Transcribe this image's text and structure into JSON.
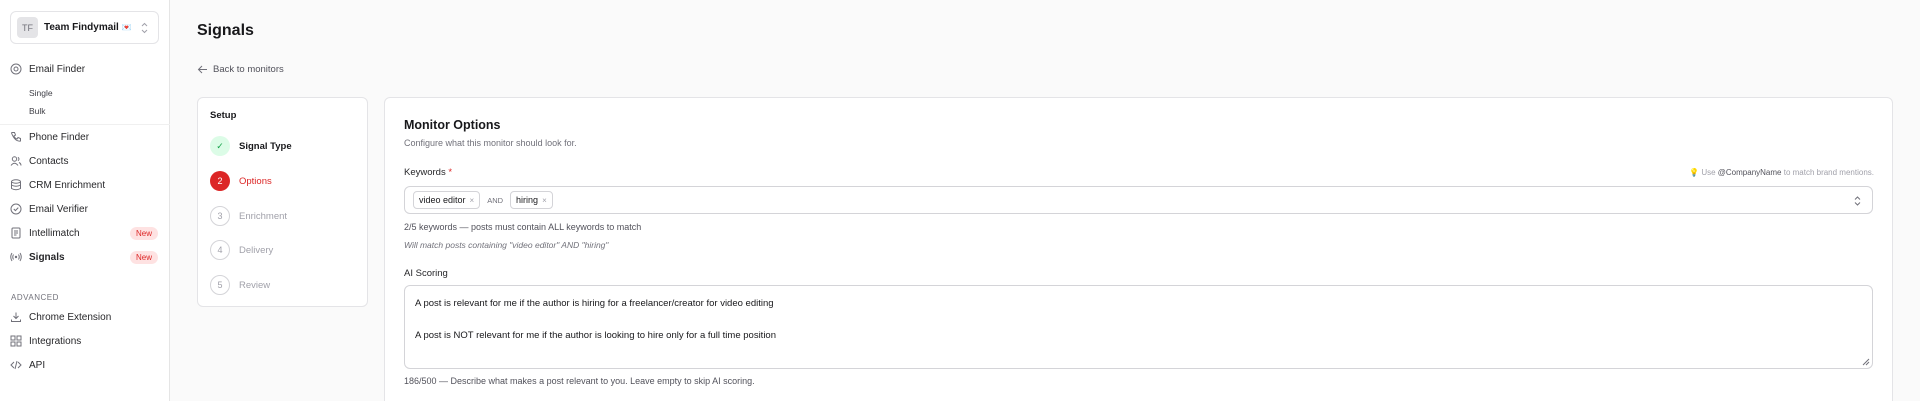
{
  "sidebar": {
    "team": {
      "initials": "TF",
      "name": "Team Findymail",
      "emoji": "💌"
    },
    "email_finder": "Email Finder",
    "single": "Single",
    "bulk": "Bulk",
    "phone_finder": "Phone Finder",
    "contacts": "Contacts",
    "crm_enrichment": "CRM Enrichment",
    "email_verifier": "Email Verifier",
    "intellimatch": "Intellimatch",
    "intellimatch_badge": "New",
    "signals": "Signals",
    "signals_badge": "New",
    "advanced_label": "ADVANCED",
    "chrome_extension": "Chrome Extension",
    "integrations": "Integrations",
    "api": "API"
  },
  "page": {
    "title": "Signals",
    "back": "Back to monitors"
  },
  "steps": {
    "title": "Setup",
    "items": [
      {
        "num": "✓",
        "label": "Signal Type",
        "state": "done"
      },
      {
        "num": "2",
        "label": "Options",
        "state": "active"
      },
      {
        "num": "3",
        "label": "Enrichment",
        "state": "todo"
      },
      {
        "num": "4",
        "label": "Delivery",
        "state": "todo"
      },
      {
        "num": "5",
        "label": "Review",
        "state": "todo"
      }
    ]
  },
  "options": {
    "title": "Monitor Options",
    "description": "Configure what this monitor should look for.",
    "keywords_label": "Keywords",
    "required_mark": "*",
    "hint_prefix": "Use",
    "hint_token": "@CompanyName",
    "hint_suffix": "to match brand mentions.",
    "chips": [
      "video editor",
      "hiring"
    ],
    "chip_remove": "×",
    "and_label": "AND",
    "keyword_count": "2/5 keywords — posts must contain ALL keywords to match",
    "keyword_match": "Will match posts containing \"video editor\" AND \"hiring\"",
    "ai_label": "AI Scoring",
    "ai_line1": "A post is relevant for me if the author is hiring for a freelancer/creator for video editing",
    "ai_line2": "A post is NOT relevant for me if the author is looking to hire only for a full time position",
    "ai_count": "186/500 — Describe what makes a post relevant to you. Leave empty to skip AI scoring."
  },
  "colors": {
    "accent": "#dc2626",
    "success": "#16a34a",
    "badge_bg": "#fee2e2"
  }
}
